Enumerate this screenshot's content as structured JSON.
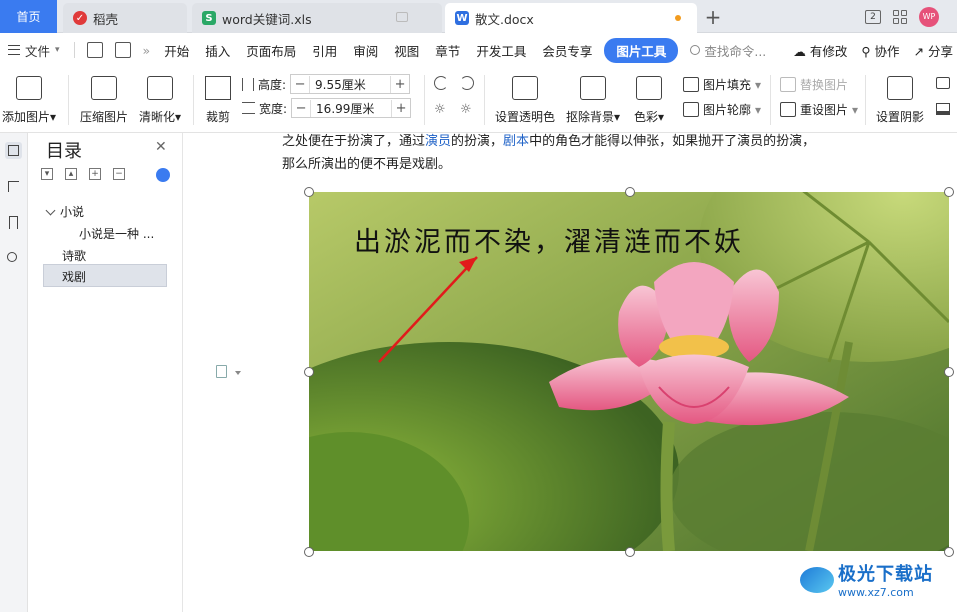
{
  "tabs": {
    "home": "首页",
    "items": [
      {
        "label": "稻壳",
        "icon": "daoke-icon",
        "color": "#e03a3a"
      },
      {
        "label": "word关键词.xls",
        "icon": "sheet-icon",
        "color": "#2aa866"
      },
      {
        "label": "散文.docx",
        "icon": "word-icon",
        "color": "#2f6fe0"
      }
    ],
    "add": "+",
    "avatar": "WP"
  },
  "menu": {
    "file": "文件",
    "items": [
      "开始",
      "插入",
      "页面布局",
      "引用",
      "审阅",
      "视图",
      "章节",
      "开发工具",
      "会员专享"
    ],
    "active": "图片工具",
    "search": "查找命令...",
    "right": [
      "有修改",
      "协作",
      "分享"
    ]
  },
  "ribbon": {
    "add_image": "添加图片",
    "compress": "压缩图片",
    "sharpen": "清晰化",
    "crop": "裁剪",
    "height_label": "高度:",
    "height_value": "9.55厘米",
    "width_label": "宽度:",
    "width_value": "16.99厘米",
    "transparent": "设置透明色",
    "remove_bg": "抠除背景",
    "color": "色彩",
    "fill": "图片填充",
    "outline": "图片轮廓",
    "replace": "替换图片",
    "reset": "重设图片",
    "shadow": "设置阴影"
  },
  "outline": {
    "title": "目录",
    "items": [
      {
        "label": "小说",
        "level": 1
      },
      {
        "label": "小说是一种 ...",
        "level": 2
      },
      {
        "label": "诗歌",
        "level": 1
      },
      {
        "label": "戏剧",
        "level": 1
      }
    ]
  },
  "document": {
    "line1_a": "之处便在于扮演了，通过",
    "line1_link1": "演员",
    "line1_b": "的扮演，",
    "line1_link2": "剧本",
    "line1_c": "中的角色才能得以伸张，如果抛开了演员的扮演，",
    "line2": "那么所演出的便不再是戏剧。",
    "image_caption": "出淤泥而不染，濯清涟而不妖"
  },
  "watermark": {
    "name": "极光下载站",
    "url": "www.xz7.com"
  },
  "colors": {
    "accent": "#3a7bf0",
    "link": "#2264c8"
  }
}
